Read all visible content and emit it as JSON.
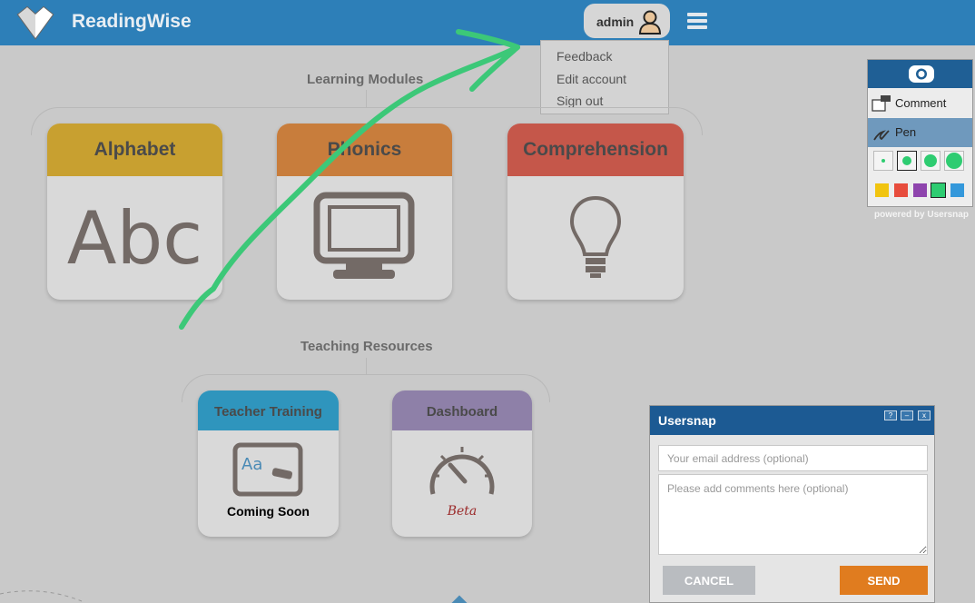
{
  "header": {
    "brand": "ReadingWise",
    "user_name": "admin",
    "colors": {
      "bar": "#2d7fb8"
    }
  },
  "user_menu": {
    "items": [
      "Feedback",
      "Edit account",
      "Sign out"
    ]
  },
  "learning_modules": {
    "title": "Learning Modules",
    "cards": [
      {
        "label": "Alphabet",
        "color": "#c8a030",
        "icon": "abc-text-icon",
        "icon_text": "Abc"
      },
      {
        "label": "Phonics",
        "color": "#c87d3c",
        "icon": "monitor-icon"
      },
      {
        "label": "Comprehension",
        "color": "#c5574a",
        "icon": "lightbulb-icon"
      }
    ]
  },
  "teaching_resources": {
    "title": "Teaching Resources",
    "cards": [
      {
        "label": "Teacher Training",
        "color": "#2f95bd",
        "icon": "whiteboard-icon",
        "sub": "Coming Soon",
        "sub_color": "#444444"
      },
      {
        "label": "Dashboard",
        "color": "#8e80a8",
        "icon": "gauge-icon",
        "sub": "Beta",
        "sub_color": "#9b2a2a"
      }
    ]
  },
  "usersnap_toolbar": {
    "items": [
      {
        "label": "Comment",
        "icon": "comment-icon"
      },
      {
        "label": "Pen",
        "icon": "pen-icon",
        "selected": true
      }
    ],
    "pen_sizes": [
      "small",
      "medium",
      "large",
      "xlarge"
    ],
    "selected_pen_size": "medium",
    "colors": [
      "#f1c40f",
      "#e74c3c",
      "#8e44ad",
      "#2ecc71",
      "#3498db"
    ],
    "powered_by": "powered by Usersnap"
  },
  "usersnap_dialog": {
    "title": "Usersnap",
    "controls": [
      "?",
      "–",
      "x"
    ],
    "email_placeholder": "Your email address (optional)",
    "comment_placeholder": "Please add comments here (optional)",
    "cancel_label": "CANCEL",
    "send_label": "SEND"
  },
  "annotation": {
    "color": "#3cc878",
    "shape": "arrow"
  }
}
